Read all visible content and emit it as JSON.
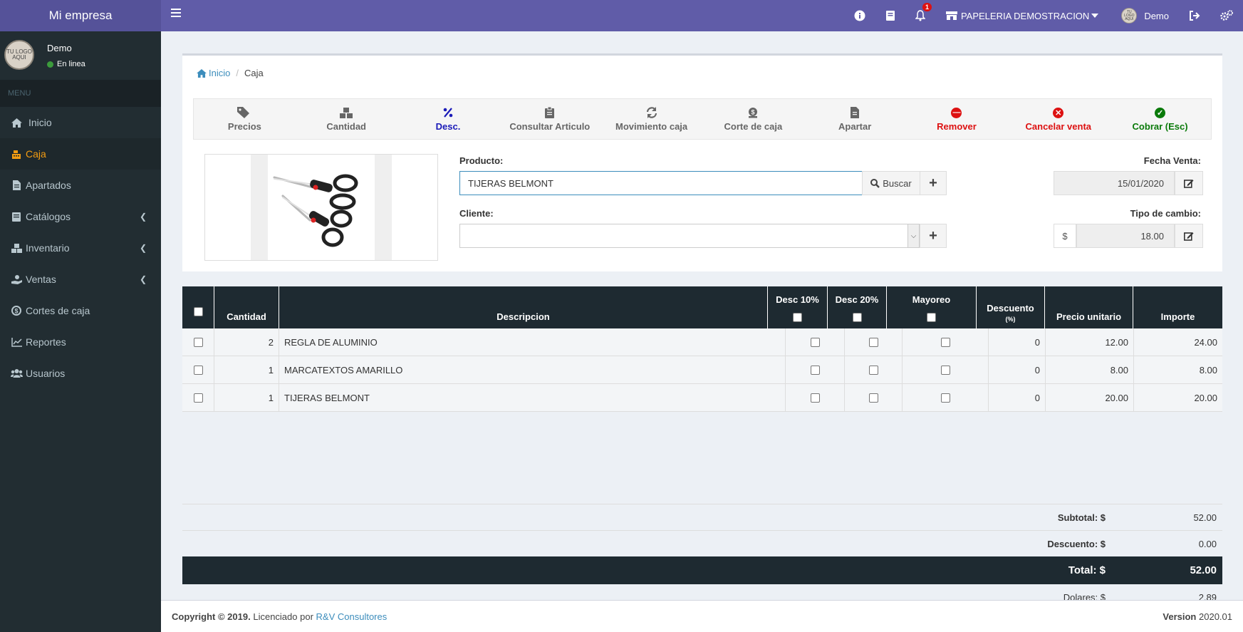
{
  "app": {
    "brand": "Mi empresa",
    "notification_count": "1",
    "store_name": "PAPELERIA DEMOSTRACION",
    "user_name": "Demo",
    "logo_text": "TU LOGO AQUI"
  },
  "sidebar": {
    "user": "Demo",
    "status": "En linea",
    "menu_header": "MENU",
    "items": [
      {
        "label": "Inicio",
        "icon": "home-icon"
      },
      {
        "label": "Caja",
        "icon": "cash-register-icon"
      },
      {
        "label": "Apartados",
        "icon": "file-icon"
      },
      {
        "label": "Catálogos",
        "icon": "book-icon"
      },
      {
        "label": "Inventario",
        "icon": "boxes-icon"
      },
      {
        "label": "Ventas",
        "icon": "hand-money-icon"
      },
      {
        "label": "Cortes de caja",
        "icon": "coin-icon"
      },
      {
        "label": "Reportes",
        "icon": "line-chart-icon"
      },
      {
        "label": "Usuarios",
        "icon": "users-icon"
      }
    ]
  },
  "breadcrumb": {
    "home": "Inicio",
    "current": "Caja"
  },
  "toolbar": [
    {
      "label": "Precios",
      "icon": "tags-icon"
    },
    {
      "label": "Cantidad",
      "icon": "boxes-icon"
    },
    {
      "label": "Desc.",
      "icon": "percent-icon"
    },
    {
      "label": "Consultar Articulo",
      "icon": "clipboard-icon"
    },
    {
      "label": "Movimiento caja",
      "icon": "refresh-icon"
    },
    {
      "label": "Corte de caja",
      "icon": "coin-icon"
    },
    {
      "label": "Apartar",
      "icon": "file-icon"
    },
    {
      "label": "Remover",
      "icon": "minus-circle-icon"
    },
    {
      "label": "Cancelar venta",
      "icon": "times-circle-icon"
    },
    {
      "label": "Cobrar (Esc)",
      "icon": "check-circle-icon"
    }
  ],
  "form": {
    "product_label": "Producto:",
    "product_value": "TIJERAS BELMONT",
    "search_label": "Buscar",
    "client_label": "Cliente:",
    "client_value": "",
    "date_label": "Fecha Venta:",
    "date_value": "15/01/2020",
    "rate_label": "Tipo de cambio:",
    "currency_symbol": "$",
    "rate_value": "18.00"
  },
  "table": {
    "headers": {
      "qty": "Cantidad",
      "desc": "Descripcion",
      "d10": "Desc 10%",
      "d20": "Desc 20%",
      "mayoreo": "Mayoreo",
      "descuento": "Descuento",
      "descuento_sub": "(%)",
      "precio": "Precio unitario",
      "importe": "Importe"
    },
    "rows": [
      {
        "qty": "2",
        "desc": "REGLA DE ALUMINIO",
        "descuento": "0",
        "precio": "12.00",
        "importe": "24.00"
      },
      {
        "qty": "1",
        "desc": "MARCATEXTOS AMARILLO",
        "descuento": "0",
        "precio": "8.00",
        "importe": "8.00"
      },
      {
        "qty": "1",
        "desc": "TIJERAS BELMONT",
        "descuento": "0",
        "precio": "20.00",
        "importe": "20.00"
      }
    ]
  },
  "totals": {
    "subtotal_label": "Subtotal: $",
    "subtotal": "52.00",
    "discount_label": "Descuento: $",
    "discount": "0.00",
    "total_label": "Total: $",
    "total": "52.00",
    "dollars_label": "Dolares: $",
    "dollars": "2.89"
  },
  "footer": {
    "copyright": "Copyright © 2019.",
    "licensed": "Licenciado por",
    "company": "R&V Consultores",
    "version_label": "Version",
    "version": "2020.01"
  },
  "colors": {
    "header": "#605ca8",
    "sidebar": "#222d32",
    "active": "#f39c12",
    "table_head": "#1e2a31"
  }
}
